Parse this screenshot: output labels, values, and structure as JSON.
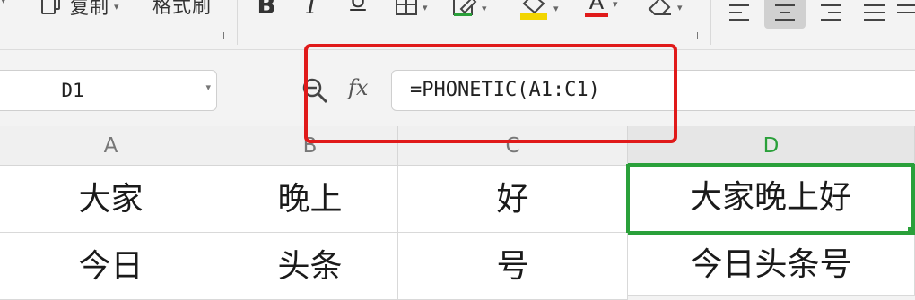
{
  "ribbon": {
    "copy_label": "复制",
    "format_painter_label": "格式刷",
    "bold_label": "B",
    "italic_label": "I",
    "underline_label": "U",
    "font_color_label": "A",
    "colors": {
      "highlight": "#f2d500",
      "font_color": "#e01a1a",
      "active_button_bg": "#d0d0d0"
    }
  },
  "formula_bar": {
    "name_box_value": "D1",
    "fx_label": "fx",
    "formula": "=PHONETIC(A1:C1)",
    "highlight_color": "#e01a1a"
  },
  "grid": {
    "columns": [
      "A",
      "B",
      "C",
      "D"
    ],
    "selected_column": "D",
    "selection_color": "#2aa03a",
    "rows": [
      [
        "大家",
        "晚上",
        "好",
        "大家晚上好"
      ],
      [
        "今日",
        "头条",
        "号",
        "今日头条号"
      ]
    ]
  }
}
